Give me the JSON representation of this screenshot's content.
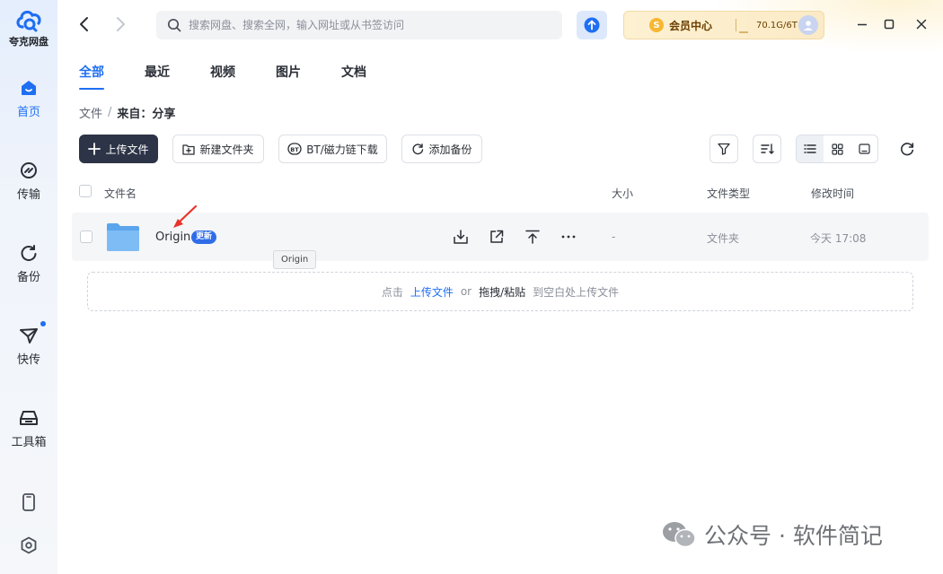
{
  "app": {
    "logo_text": "夸克网盘"
  },
  "sidebar": {
    "items": [
      {
        "label": "首页",
        "icon": "home-icon",
        "active": true
      },
      {
        "label": "传输",
        "icon": "transfer-icon"
      },
      {
        "label": "备份",
        "icon": "backup-icon"
      },
      {
        "label": "快传",
        "icon": "send-icon",
        "dot": true
      },
      {
        "label": "工具箱",
        "icon": "toolbox-icon"
      }
    ],
    "bottom": [
      {
        "icon": "phone-icon"
      },
      {
        "icon": "settings-icon"
      }
    ]
  },
  "topbar": {
    "search_placeholder": "搜索网盘、搜索全网，输入网址或从书签访问",
    "vip_badge": "S",
    "vip_label": "会员中心",
    "storage": "70.1G/6T"
  },
  "tabs": [
    {
      "label": "全部",
      "active": true
    },
    {
      "label": "最近"
    },
    {
      "label": "视频"
    },
    {
      "label": "图片"
    },
    {
      "label": "文档"
    }
  ],
  "breadcrumb": {
    "root": "文件",
    "sep": "/",
    "current": "来自：分享"
  },
  "toolbar": {
    "upload": "上传文件",
    "new_folder": "新建文件夹",
    "bt": "BT/磁力链下载",
    "backup": "添加备份"
  },
  "table": {
    "headers": {
      "name": "文件名",
      "size": "大小",
      "type": "文件类型",
      "modified": "修改时间"
    },
    "rows": [
      {
        "name": "Origin",
        "badge": "更新",
        "size": "-",
        "type": "文件夹",
        "modified": "今天 17:08"
      }
    ]
  },
  "tooltip": "Origin",
  "dropzone": {
    "prefix": "点击",
    "link": "上传文件",
    "or": "or",
    "strong": "拖拽/粘贴",
    "suffix": "到空白处上传文件"
  },
  "watermark": "公众号 · 软件简记",
  "colors": {
    "accent": "#1e6ff2",
    "primary_button": "#2d3447",
    "vip_bg": "#fdf1d2"
  }
}
